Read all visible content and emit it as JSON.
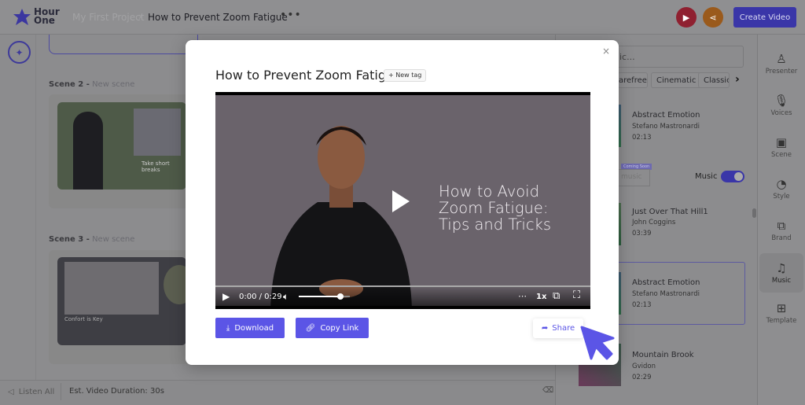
{
  "header": {
    "logo": "Hour One",
    "breadcrumb_project": "My First Project",
    "breadcrumb_separator": "›",
    "breadcrumb_video": "How to Prevent Zoom Fatigue",
    "more": "•••",
    "create_video": "Create Video"
  },
  "scenes": [
    {
      "number": "Scene 2 -",
      "name": "New scene",
      "caption": "Take short breaks"
    },
    {
      "number": "Scene 3 -",
      "name": "New scene",
      "caption": "Confort is Key"
    }
  ],
  "footer": {
    "listen_all": "Listen All",
    "duration": "Est. Video Duration: 30s"
  },
  "music_panel": {
    "search_placeholder": "ic...",
    "tags": [
      "arefree",
      "Cinematic",
      "Classica"
    ],
    "coming_soon": "Coming Soon",
    "upload_label": "music",
    "music_toggle_label": "Music",
    "music_enabled": true,
    "tracks": [
      {
        "title": "Abstract Emotion",
        "artist": "Stefano Mastronardi",
        "duration": "02:13"
      },
      {
        "title": "Just Over That Hill1",
        "artist": "John Coggins",
        "duration": "03:39"
      },
      {
        "title": "Abstract Emotion",
        "artist": "Stefano Mastronardi",
        "duration": "02:13"
      },
      {
        "title": "Mountain Brook",
        "artist": "Gvidon",
        "duration": "02:29"
      }
    ]
  },
  "sidebar": {
    "items": [
      {
        "label": "Presenter",
        "icon": "person-icon"
      },
      {
        "label": "Voices",
        "icon": "microphone-icon"
      },
      {
        "label": "Scene",
        "icon": "image-icon"
      },
      {
        "label": "Style",
        "icon": "palette-icon"
      },
      {
        "label": "Brand",
        "icon": "brand-icon"
      },
      {
        "label": "Music",
        "icon": "music-icon",
        "active": true
      },
      {
        "label": "Template",
        "icon": "template-icon"
      }
    ]
  },
  "modal": {
    "title": "How to Prevent Zoom Fatigue",
    "new_tag": "+ New tag",
    "close": "×",
    "video": {
      "overlay_text_line1": "How to Avoid",
      "overlay_text_line2": "Zoom Fatigue:",
      "overlay_text_line3": "Tips and Tricks",
      "time": "0:00 / 0:29",
      "speed": "1x",
      "volume_level": 0.8,
      "progress": 0
    },
    "download": "Download",
    "copy_link": "Copy Link",
    "share": "Share"
  },
  "colors": {
    "accent": "#5b55e6",
    "play_red": "#d2213f",
    "share_orange": "#e07b1a"
  }
}
